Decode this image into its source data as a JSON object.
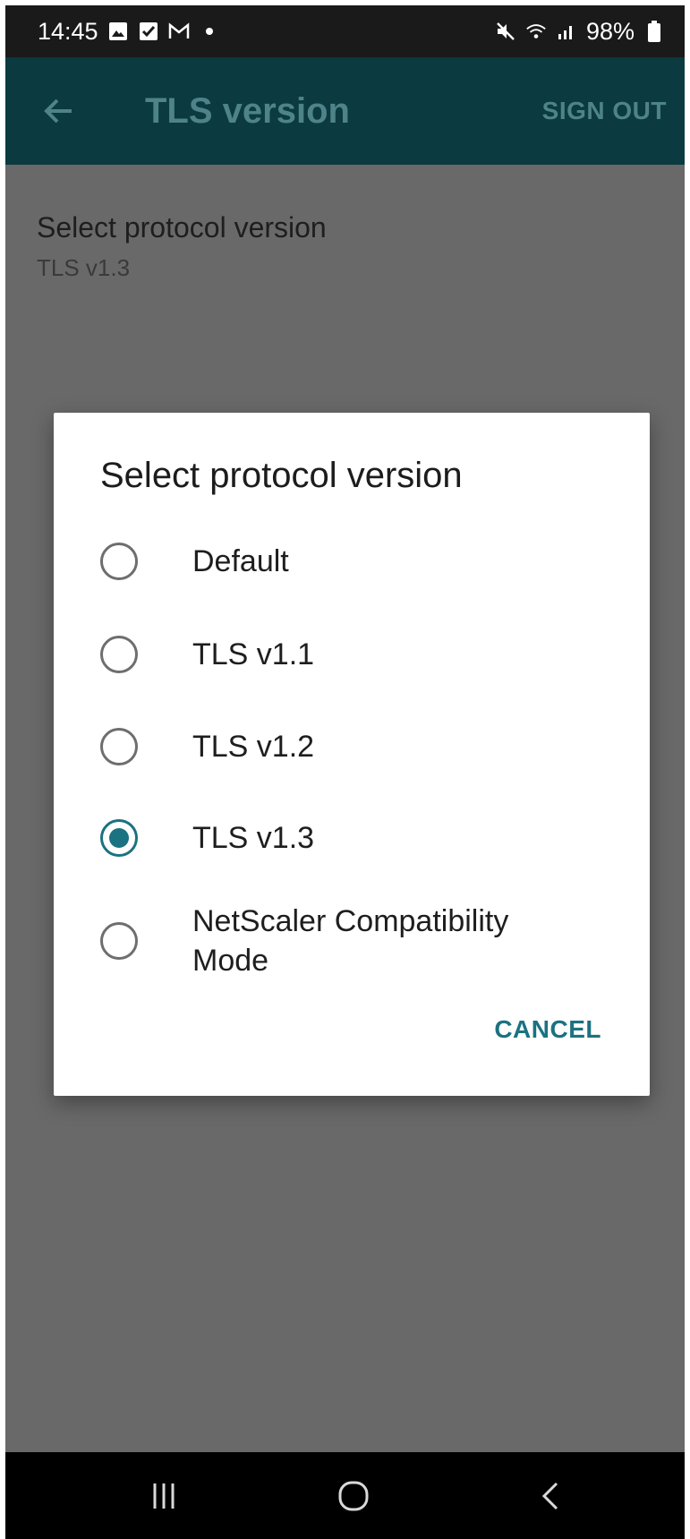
{
  "status_bar": {
    "time": "14:45",
    "battery": "98%",
    "icons": [
      "gallery-icon",
      "check-icon",
      "gmail-icon",
      "dot-icon",
      "mute-icon",
      "wifi-icon",
      "signal-icon",
      "battery-icon"
    ]
  },
  "app_bar": {
    "title": "TLS version",
    "sign_out_label": "SIGN OUT",
    "color": "#0b3a40"
  },
  "preference": {
    "title": "Select protocol version",
    "summary": "TLS v1.3"
  },
  "dialog": {
    "title": "Select protocol version",
    "options": [
      {
        "label": "Default",
        "checked": false
      },
      {
        "label": "TLS v1.1",
        "checked": false
      },
      {
        "label": "TLS v1.2",
        "checked": false
      },
      {
        "label": "TLS v1.3",
        "checked": true
      },
      {
        "label": "NetScaler Compatibility Mode",
        "checked": false
      }
    ],
    "cancel_label": "CANCEL",
    "accent": "#1b7280"
  },
  "nav_bar": {
    "buttons": [
      "recent-apps-icon",
      "home-icon",
      "back-icon"
    ]
  }
}
